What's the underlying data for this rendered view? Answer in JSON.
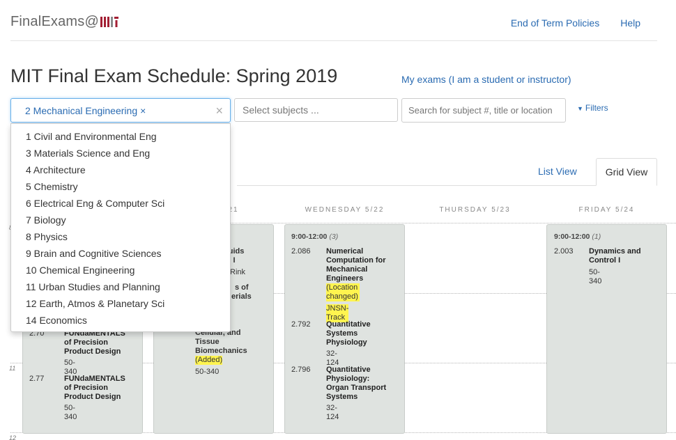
{
  "header": {
    "brand_text": "FinalExams@",
    "brand_logo_text": "MIT",
    "links": [
      "End of Term Policies",
      "Help"
    ]
  },
  "page": {
    "title": "MIT Final Exam Schedule: Spring 2019",
    "my_exams_link": "My exams (I am a student or instructor)"
  },
  "filters": {
    "department_tag": "2 Mechanical Engineering",
    "tag_remove": "×",
    "clear": "×",
    "subjects_placeholder": "Select subjects ...",
    "search_placeholder": "Search for subject #, title or location",
    "filters_label": "Filters",
    "department_options": [
      "1 Civil and Environmental Eng",
      "3 Materials Science and Eng",
      "4 Architecture",
      "5 Chemistry",
      "6 Electrical Eng & Computer Sci",
      "7 Biology",
      "8 Physics",
      "9 Brain and Cognitive Sciences",
      "10 Chemical Engineering",
      "11 Urban Studies and Planning",
      "12 Earth, Atmos & Planetary Sci",
      "14 Economics"
    ]
  },
  "views": {
    "list": "List View",
    "grid": "Grid View",
    "active": "Grid View"
  },
  "days": {
    "tuesday_partial": "21",
    "wednesday": "WEDNESDAY 5/22",
    "thursday": "THURSDAY 5/23",
    "friday": "FRIDAY 5/24"
  },
  "hours": [
    "8",
    "11",
    "12"
  ],
  "monday": {
    "exams": [
      {
        "num": "2.70",
        "title": "FUNdaMENTALS of Precision Product Design",
        "loc": "50-340"
      },
      {
        "num": "2.77",
        "title": "FUNdaMENTALS of Precision Product Design",
        "loc": "50-340"
      }
    ]
  },
  "tuesday": {
    "partials": [
      "Fluids",
      "ng I",
      "Rink",
      "s of",
      "erials",
      ","
    ],
    "exam_title_tail": "Cellular, and Tissue Biomechanics",
    "exam_note": "(Added)",
    "exam_loc": "50-340"
  },
  "wednesday": {
    "time": "9:00-12:00",
    "count": "(3)",
    "exams": [
      {
        "num": "2.086",
        "title": "Numerical Computation for Mechanical Engineers",
        "note": "(Location changed)",
        "track": "JNSN-Track"
      },
      {
        "num": "2.792",
        "title": "Quantitative Systems Physiology",
        "loc": "32-124"
      },
      {
        "num": "2.796",
        "title": "Quantitative Physiology: Organ Transport Systems",
        "loc": "32-124"
      }
    ]
  },
  "friday": {
    "time": "9:00-12:00",
    "count": "(1)",
    "exams": [
      {
        "num": "2.003",
        "title": "Dynamics and Control I",
        "loc": "50-340"
      }
    ]
  },
  "colors": {
    "link": "#2a6bb2",
    "slot_bg": "#dfe3e0",
    "highlight": "#fff44f",
    "focus": "#66afe9"
  }
}
